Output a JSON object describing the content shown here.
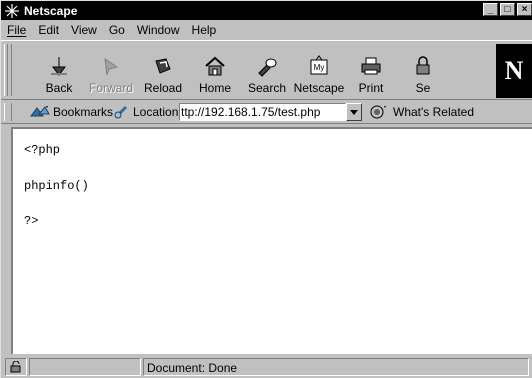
{
  "window": {
    "title": "Netscape",
    "controls": [
      "_",
      "□",
      "×"
    ]
  },
  "menu": [
    {
      "label": "File",
      "accel": "F"
    },
    {
      "label": "Edit",
      "accel": "E"
    },
    {
      "label": "View",
      "accel": "V"
    },
    {
      "label": "Go",
      "accel": "G"
    },
    {
      "label": "Window",
      "accel": "W"
    },
    {
      "label": "Help",
      "accel": "H"
    }
  ],
  "toolbar": {
    "buttons": [
      {
        "label": "Back",
        "icon": "back-arrow-icon",
        "enabled": true
      },
      {
        "label": "Forward",
        "icon": "forward-arrow-icon",
        "enabled": false
      },
      {
        "label": "Reload",
        "icon": "reload-icon",
        "enabled": true
      },
      {
        "label": "Home",
        "icon": "home-icon",
        "enabled": true
      },
      {
        "label": "Search",
        "icon": "search-flashlight-icon",
        "enabled": true
      },
      {
        "label": "Netscape",
        "icon": "my-netscape-icon",
        "enabled": true
      },
      {
        "label": "Print",
        "icon": "printer-icon",
        "enabled": true
      },
      {
        "label": "Se",
        "icon": "security-icon",
        "enabled": true
      }
    ],
    "logo": "N"
  },
  "location_bar": {
    "bookmarks_label": "Bookmarks",
    "location_label": "Location:",
    "url": "ttp://192.168.1.75/test.php",
    "whats_related_label": "What's Related"
  },
  "content": {
    "lines": [
      "<?php",
      "phpinfo()",
      "?>"
    ]
  },
  "status": {
    "text": "Document: Done"
  },
  "colors": {
    "chrome": "#c0c0c0",
    "titlebar": "#000000",
    "content_bg": "#ffffff"
  }
}
